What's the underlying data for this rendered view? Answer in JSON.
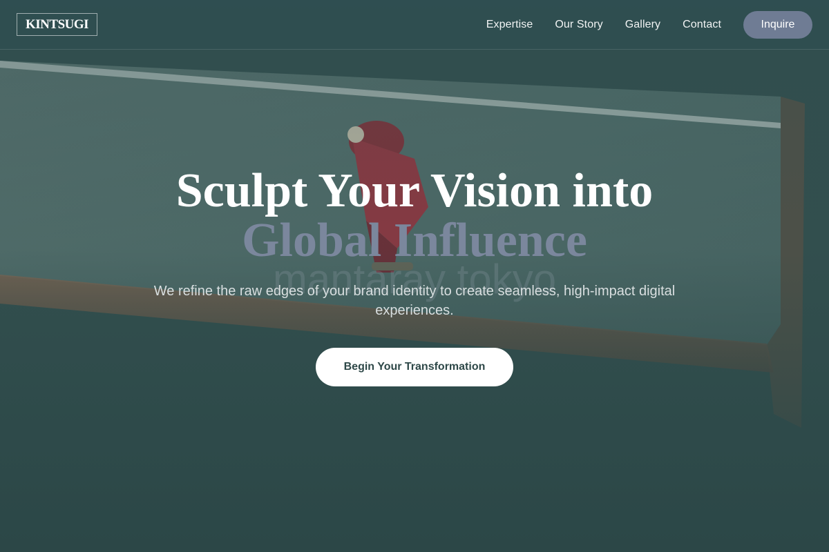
{
  "header": {
    "logo": "KINTSUGI",
    "nav": [
      "Expertise",
      "Our Story",
      "Gallery",
      "Contact"
    ],
    "cta_label": "Inquire"
  },
  "hero": {
    "headline_line1": "Sculpt Your Vision into",
    "headline_line2": "Global Influence",
    "ghost_text": "mantaray tokyo",
    "subtitle": "We refine the raw edges of your brand identity to create seamless, high-impact digital experiences.",
    "cta_label": "Begin Your Transformation"
  },
  "colors": {
    "background": "#2e4b4b",
    "header_bg": "#2f4e50",
    "accent": "#6f7c94",
    "headline_muted": "#7b879d",
    "cta_bg": "#ffffff",
    "cta_text": "#2e4848"
  },
  "background_image": {
    "description_icon": "photo-skateboarder-on-ramp"
  }
}
